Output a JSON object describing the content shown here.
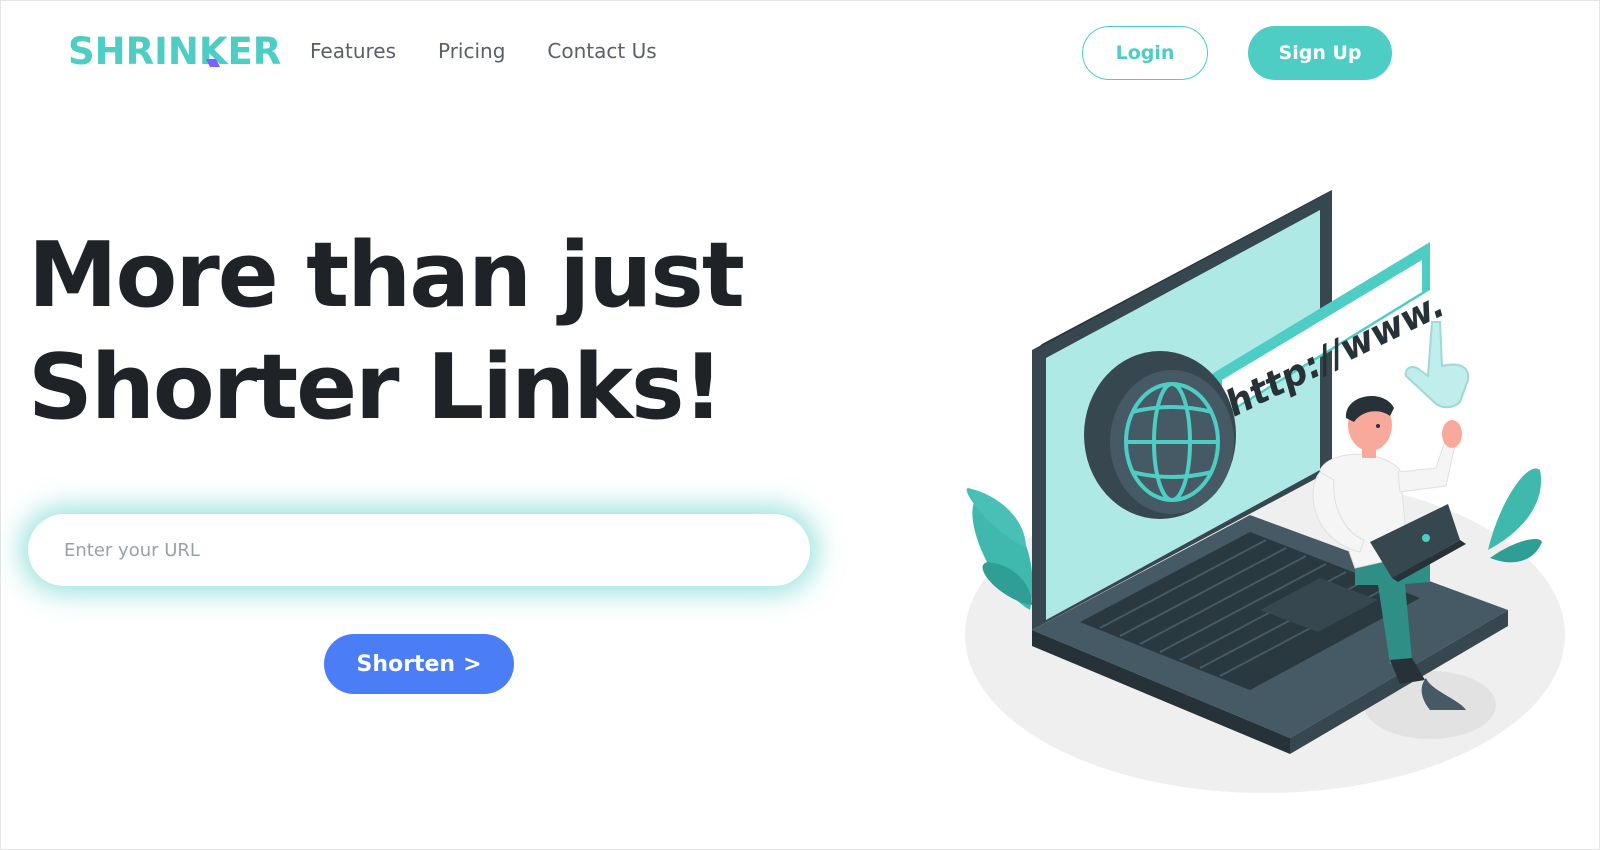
{
  "brand": {
    "logo_text": "SHRINKER",
    "accent": "#4ecdc4",
    "mark_color": "#7b61ff"
  },
  "nav": {
    "links": [
      {
        "label": "Features"
      },
      {
        "label": "Pricing"
      },
      {
        "label": "Contact Us"
      }
    ],
    "login_label": "Login",
    "signup_label": "Sign Up"
  },
  "hero": {
    "title_line1": "More than just",
    "title_line2": "Shorter Links!",
    "url_placeholder": "Enter your URL",
    "url_value": "",
    "shorten_label": "Shorten",
    "shorten_chevron": ">",
    "shorten_color": "#4b7ef6"
  },
  "illustration": {
    "address_text": "http://www.",
    "icons": [
      "globe-icon",
      "pointer-hand-icon",
      "laptop-icon",
      "person-with-laptop",
      "plant-leaf"
    ]
  }
}
